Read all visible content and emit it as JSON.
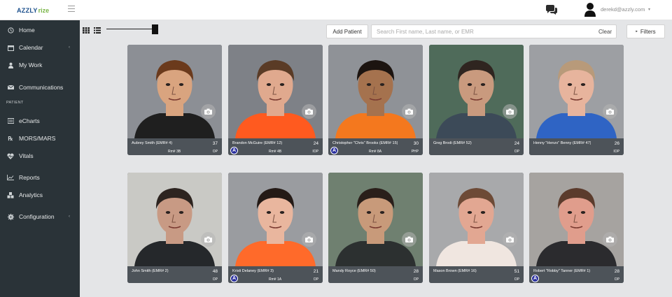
{
  "header": {
    "logo_part1": "AZZLY",
    "logo_part2": "rize",
    "user_email": "derekd@azzly.com",
    "caret": "▾"
  },
  "sidebar": {
    "items": [
      {
        "label": "Home",
        "icon": "home-icon"
      },
      {
        "label": "Calendar",
        "icon": "calendar-icon",
        "has_children": true
      },
      {
        "label": "My Work",
        "icon": "user-icon"
      },
      {
        "label": "Communications",
        "icon": "envelope-icon"
      },
      {
        "label": "eCharts",
        "icon": "chart-icon"
      },
      {
        "label": "MORS/MARS",
        "icon": "rx-icon"
      },
      {
        "label": "Vitals",
        "icon": "heartbeat-icon"
      },
      {
        "label": "Reports",
        "icon": "line-chart-icon"
      },
      {
        "label": "Analytics",
        "icon": "cubes-icon"
      },
      {
        "label": "Configuration",
        "icon": "gear-icon",
        "has_children": true
      }
    ],
    "section_patient": "PATIENT",
    "chevron": "‹"
  },
  "toolbar": {
    "add_patient": "Add Patient",
    "search_placeholder": "Search First name, Last name, or EMR",
    "search_value": "",
    "clear": "Clear",
    "filters": "Filters",
    "filters_tri": "▸"
  },
  "patients": [
    {
      "name": "Aubrey Smith (EMR# 4)",
      "age": "37",
      "room": "Rm# 3B",
      "program": "OP",
      "badge": "",
      "skin": "#d9a47f",
      "hair": "#6b3a1c",
      "shirt": "#1f1f1f",
      "bg": "#8c8f95"
    },
    {
      "name": "Brandon McGuire (EMR# 12)",
      "age": "24",
      "room": "Rm# 4B",
      "program": "IOP",
      "badge": "A",
      "skin": "#e0a98e",
      "hair": "#5a3b26",
      "shirt": "#ff5a1f",
      "bg": "#7e8187"
    },
    {
      "name": "Christopher \"Chris\" Brooks (EMR# 15)",
      "age": "30",
      "room": "Rm# 8A",
      "program": "PHP",
      "badge": "A",
      "skin": "#a5724e",
      "hair": "#1c1410",
      "shirt": "#f4781e",
      "bg": "#8f9297"
    },
    {
      "name": "Greg Brodi (EMR# 52)",
      "age": "24",
      "room": "",
      "program": "OP",
      "badge": "",
      "skin": "#c99a7e",
      "hair": "#2f2520",
      "shirt": "#3c4a58",
      "bg": "#4f6b5a"
    },
    {
      "name": "Henny \"Henzo\" Benny (EMR# 47)",
      "age": "26",
      "room": "",
      "program": "IOP",
      "badge": "",
      "skin": "#e7b49d",
      "hair": "#b89a7a",
      "shirt": "#2f64c4",
      "bg": "#9d9fa3"
    },
    {
      "name": "John Smith (EMR# 2)",
      "age": "48",
      "room": "",
      "program": "OP",
      "badge": "",
      "skin": "#c89a84",
      "hair": "#2d2420",
      "shirt": "#25282b",
      "bg": "#c9c9c5"
    },
    {
      "name": "Kristi Delaney (EMR# 3)",
      "age": "21",
      "room": "Rm# 1A",
      "program": "OP",
      "badge": "A",
      "skin": "#e9b69e",
      "hair": "#241a16",
      "shirt": "#ff6a2a",
      "bg": "#9a9ca0"
    },
    {
      "name": "Mandy Royce (EMR# 50)",
      "age": "28",
      "room": "",
      "program": "OP",
      "badge": "",
      "skin": "#c89a7a",
      "hair": "#2a1f1a",
      "shirt": "#2c3030",
      "bg": "#6f8070"
    },
    {
      "name": "Mason Brown (EMR# 16)",
      "age": "51",
      "room": "",
      "program": "OP",
      "badge": "",
      "skin": "#e2a792",
      "hair": "#6d4a36",
      "shirt": "#f0e6e0",
      "bg": "#a8a9ab"
    },
    {
      "name": "Robert \"Robby\" Tanner (EMR# 1)",
      "age": "28",
      "room": "",
      "program": "OP",
      "badge": "A",
      "skin": "#e09d8c",
      "hair": "#5b3b2c",
      "shirt": "#2b2b2e",
      "bg": "#a6a3a0"
    }
  ]
}
